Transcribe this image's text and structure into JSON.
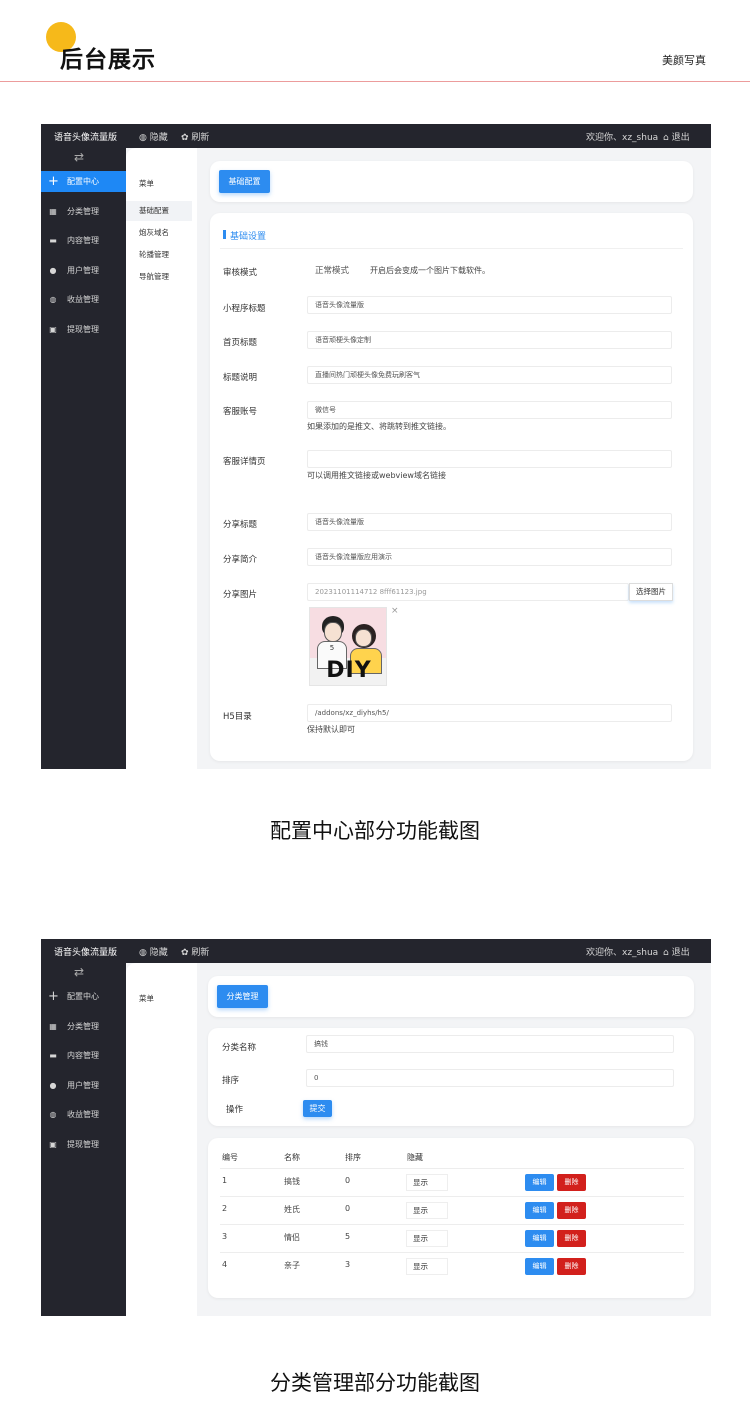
{
  "header": {
    "title": "后台展示",
    "brand": "美颜写真"
  },
  "shot1": {
    "topbar": {
      "app_name": "语音头像流量版",
      "hide_label": "隐藏",
      "refresh_label": "刷新",
      "welcome": "欢迎你、xz_shua",
      "logout_label": "退出"
    },
    "nav": [
      {
        "label": "配置中心",
        "icon": "plus-icon"
      },
      {
        "label": "分类管理",
        "icon": "grid-icon"
      },
      {
        "label": "内容管理",
        "icon": "card-icon"
      },
      {
        "label": "用户管理",
        "icon": "user-icon"
      },
      {
        "label": "收益管理",
        "icon": "globe-icon"
      },
      {
        "label": "提现管理",
        "icon": "wallet-icon"
      }
    ],
    "submenu": {
      "title": "菜单",
      "items": [
        "基础配置",
        "炮灰域名",
        "轮播管理",
        "导航管理"
      ]
    },
    "config_button": "基础配置",
    "section_title": "基础设置",
    "form": {
      "review_label": "审核模式",
      "review_value": "正常模式",
      "review_hint": "开启后会变成一个图片下载软件。",
      "mp_title_label": "小程序标题",
      "mp_title_value": "语音头像流量版",
      "home_title_label": "首页标题",
      "home_title_value": "语音顽梗头像定制",
      "title_desc_label": "标题说明",
      "title_desc_value": "直播间热门顽梗头像免费玩刷客气",
      "service_label": "客服账号",
      "service_value": "微信号",
      "service_hint": "如果添加的是推文、将跳转到推文链接。",
      "detail_label": "客服详情页",
      "detail_value": "",
      "detail_hint": "可以调用推文链接或webview域名链接",
      "share_title_label": "分享标题",
      "share_title_value": "语音头像流量版",
      "share_desc_label": "分享简介",
      "share_desc_value": "语音头像流量版应用演示",
      "share_img_label": "分享图片",
      "share_img_value": "20231101114712 8fff61123.jpg",
      "choose_label": "选择图片",
      "diy_text": "DIY",
      "remove_mark": "×",
      "h5_label": "H5目录",
      "h5_value": "/addons/xz_diyhs/h5/",
      "h5_hint": "保持默认即可"
    }
  },
  "caption1": "配置中心部分功能截图",
  "shot2": {
    "submenu_title": "菜单",
    "category_button": "分类管理",
    "form": {
      "name_label": "分类名称",
      "name_value": "搞钱",
      "sort_label": "排序",
      "sort_value": "0",
      "op_label": "操作",
      "submit_label": "提交"
    },
    "table": {
      "headers": [
        "编号",
        "名称",
        "排序",
        "隐藏"
      ],
      "rows": [
        {
          "id": "1",
          "name": "搞钱",
          "sort": "0",
          "status": "显示"
        },
        {
          "id": "2",
          "name": "姓氏",
          "sort": "0",
          "status": "显示"
        },
        {
          "id": "3",
          "name": "情侣",
          "sort": "5",
          "status": "显示"
        },
        {
          "id": "4",
          "name": "亲子",
          "sort": "3",
          "status": "显示"
        }
      ],
      "edit_label": "编辑",
      "delete_label": "删除"
    }
  },
  "caption2": "分类管理部分功能截图"
}
